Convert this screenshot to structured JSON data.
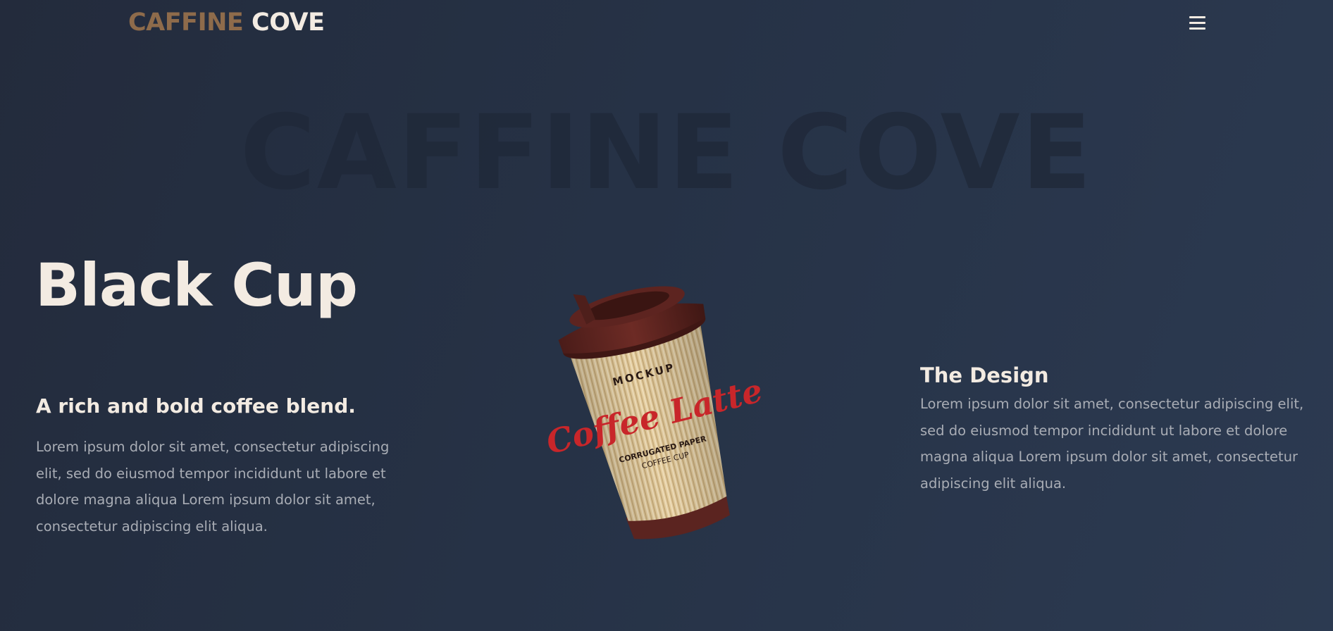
{
  "nav": {
    "logo_part1": "CAFFINE",
    "logo_part2": "COVE",
    "menu_icon": "hamburger-menu-icon"
  },
  "hero": {
    "watermark": "CAFFINE COVE",
    "title": "Black Cup",
    "subtitle": "A rich and bold coffee blend.",
    "description": "Lorem ipsum dolor sit amet, consectetur adipiscing elit, sed do eiusmod tempor incididunt ut labore et dolore magna aliqua Lorem ipsum dolor sit amet, consectetur adipiscing elit aliqua."
  },
  "design": {
    "title": "The Design",
    "description": "Lorem ipsum dolor sit amet, consectetur adipiscing elit, sed do eiusmod tempor incididunt ut labore et dolore magna aliqua Lorem ipsum dolor sit amet, consectetur adipiscing elit aliqua."
  },
  "cup": {
    "top_text": "MOCKUP",
    "brand": "Coffee Latte",
    "line1": "CORRUGATED PAPER",
    "line2": "COFFEE CUP"
  },
  "colors": {
    "accent": "#8e6b4b",
    "cream": "#f3ebe2",
    "background": "#263246",
    "body_text": "#a9adb5",
    "cup_lid": "#5b2420",
    "cup_sleeve": "#e6cfa4",
    "cup_text_red": "#c8262a"
  }
}
